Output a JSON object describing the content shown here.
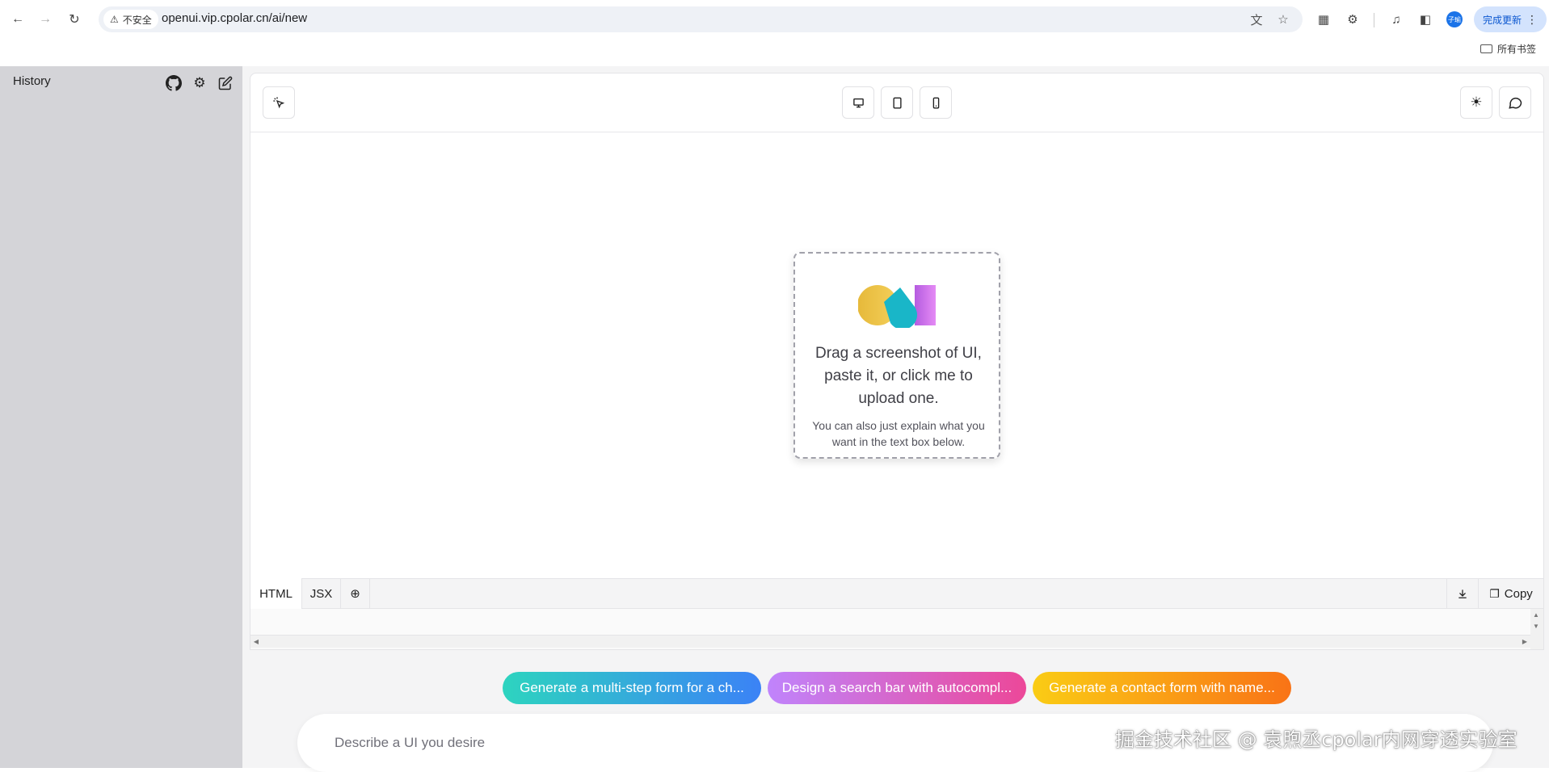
{
  "browser": {
    "security_label": "不安全",
    "url": "openui.vip.cpolar.cn/ai/new",
    "profile_initials": "子瑜",
    "update_label": "完成更新",
    "bookmarks_label": "所有书签"
  },
  "sidebar": {
    "history_label": "History"
  },
  "upload": {
    "title": "Drag a screenshot of UI, paste it, or click me to upload one.",
    "subtitle": "You can also just explain what you want in the text box below."
  },
  "code_tabs": {
    "html": "HTML",
    "jsx": "JSX",
    "copy": "Copy"
  },
  "suggestions": [
    {
      "label": "Generate a multi-step form for a ch..."
    },
    {
      "label": "Design a search bar with autocompl..."
    },
    {
      "label": "Generate a contact form with name..."
    }
  ],
  "prompt": {
    "placeholder": "Describe a UI you desire"
  },
  "watermark": "掘金技术社区 @ 袁煦丞cpolar内网穿透实验室",
  "colors": {
    "sidebar_bg": "#d4d4d8",
    "update_button_bg": "#d3e3fd",
    "chip1": [
      "#2dd4bf",
      "#3b82f6"
    ],
    "chip2": [
      "#c084fc",
      "#ec4899"
    ],
    "chip3": [
      "#facc15",
      "#f97316"
    ]
  }
}
